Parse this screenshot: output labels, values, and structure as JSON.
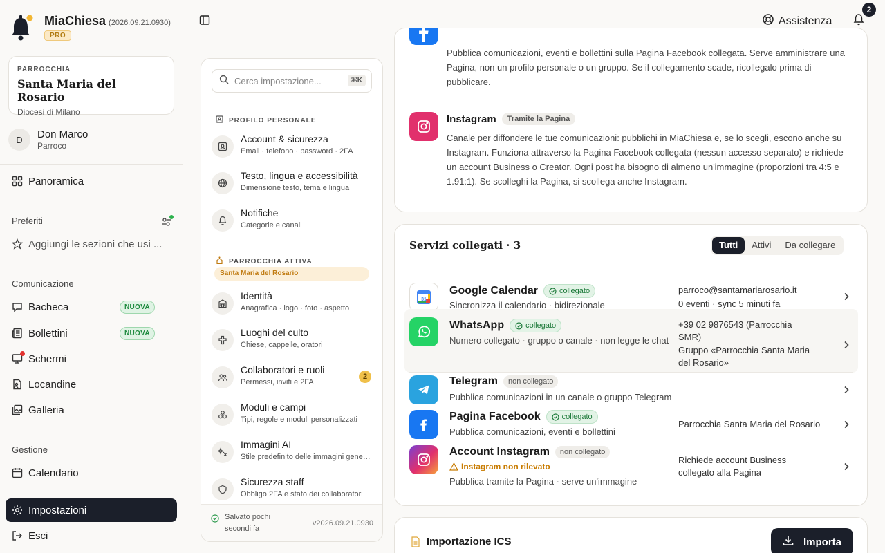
{
  "app": {
    "name": "MiaChiesa",
    "version": "(2026.09.21.0930)",
    "plan": "PRO"
  },
  "parish": {
    "eyebrow": "PARROCCHIA",
    "name": "Santa Maria del Rosario",
    "diocese": "Diocesi di Milano"
  },
  "user": {
    "initial": "D",
    "name": "Don Marco",
    "role": "Parroco"
  },
  "sidebar": {
    "overview": "Panoramica",
    "favorites_label": "Preferiti",
    "favorites_hint": "Aggiungi le sezioni che usi ...",
    "communication_label": "Comunicazione",
    "communication": [
      {
        "label": "Bacheca",
        "badge": "NUOVA"
      },
      {
        "label": "Bollettini",
        "badge": "NUOVA"
      },
      {
        "label": "Schermi"
      },
      {
        "label": "Locandine"
      },
      {
        "label": "Galleria"
      }
    ],
    "management_label": "Gestione",
    "calendar": "Calendario",
    "settings": "Impostazioni",
    "logout": "Esci"
  },
  "topbar": {
    "assist": "Assistenza",
    "notifications": "2"
  },
  "settings_nav": {
    "search_placeholder": "Cerca impostazione...",
    "shortcut": "⌘K",
    "personal_label": "PROFILO PERSONALE",
    "personal": [
      {
        "title": "Account & sicurezza",
        "sub": "Email · telefono · password · 2FA"
      },
      {
        "title": "Testo, lingua e accessibilità",
        "sub": "Dimensione testo, tema e lingua"
      },
      {
        "title": "Notifiche",
        "sub": "Categorie e canali"
      }
    ],
    "parish_label": "PARROCCHIA ATTIVA",
    "parish_pill": "Santa Maria del Rosario",
    "parish_items": [
      {
        "title": "Identità",
        "sub": "Anagrafica · logo · foto · aspetto"
      },
      {
        "title": "Luoghi del culto",
        "sub": "Chiese, cappelle, oratori"
      },
      {
        "title": "Collaboratori e ruoli",
        "sub": "Permessi, inviti e 2FA",
        "badge": "2"
      },
      {
        "title": "Moduli e campi",
        "sub": "Tipi, regole e moduli personalizzati"
      },
      {
        "title": "Immagini AI",
        "sub": "Stile predefinito delle immagini generate"
      },
      {
        "title": "Sicurezza staff",
        "sub": "Obbligo 2FA e stato dei collaboratori"
      }
    ],
    "saved": "Salvato pochi secondi fa",
    "version": "v2026.09.21.0930"
  },
  "social": {
    "facebook_desc": "Pubblica comunicazioni, eventi e bollettini sulla Pagina Facebook collegata. Serve amministrare una Pagina, non un profilo personale o un gruppo. Se il collegamento scade, ricollegalo prima di pubblicare.",
    "instagram_title": "Instagram",
    "instagram_pill": "Tramite la Pagina",
    "instagram_desc": "Canale per diffondere le tue comunicazioni: pubblichi in MiaChiesa e, se lo scegli, escono anche su Instagram. Funziona attraverso la Pagina Facebook collegata (nessun accesso separato) e richiede un account Business o Creator. Ogni post ha bisogno di almeno un'immagine (proporzioni tra 4:5 e 1.91:1). Se scolleghi la Pagina, si scollega anche Instagram."
  },
  "services": {
    "heading": "Servizi collegati · 3",
    "filters": [
      "Tutti",
      "Attivi",
      "Da collegare"
    ],
    "items": [
      {
        "name": "Google Calendar",
        "status": "collegato",
        "sub": "Sincronizza il calendario · bidirezionale",
        "right1": "parroco@santamariarosario.it",
        "right2": "0 eventi · sync 5 minuti fa"
      },
      {
        "name": "WhatsApp",
        "status": "collegato",
        "sub": "Numero collegato · gruppo o canale · non legge le chat",
        "right1": "+39 02 9876543 (Parrocchia SMR)",
        "right2": "Gruppo «Parrocchia Santa Maria del Rosario»"
      },
      {
        "name": "Telegram",
        "status": "non collegato",
        "sub": "Pubblica comunicazioni in un canale o gruppo Telegram"
      },
      {
        "name": "Pagina Facebook",
        "status": "collegato",
        "sub": "Pubblica comunicazioni, eventi e bollettini",
        "right1": "Parrocchia Santa Maria del Rosario"
      },
      {
        "name": "Account Instagram",
        "status": "non collegato",
        "warning": "Instagram non rilevato",
        "sub": "Pubblica tramite la Pagina · serve un'immagine",
        "right1": "Richiede account Business collegato alla Pagina"
      }
    ]
  },
  "ics": {
    "title": "Importazione ICS",
    "button": "Importa"
  },
  "colors": {
    "dark": "#1b1f2a",
    "success": "#1d7a3a",
    "warning": "#c87b00",
    "facebook": "#1877f2",
    "instagram": "#e1306c",
    "whatsapp": "#25d366",
    "telegram": "#2aa3df"
  }
}
